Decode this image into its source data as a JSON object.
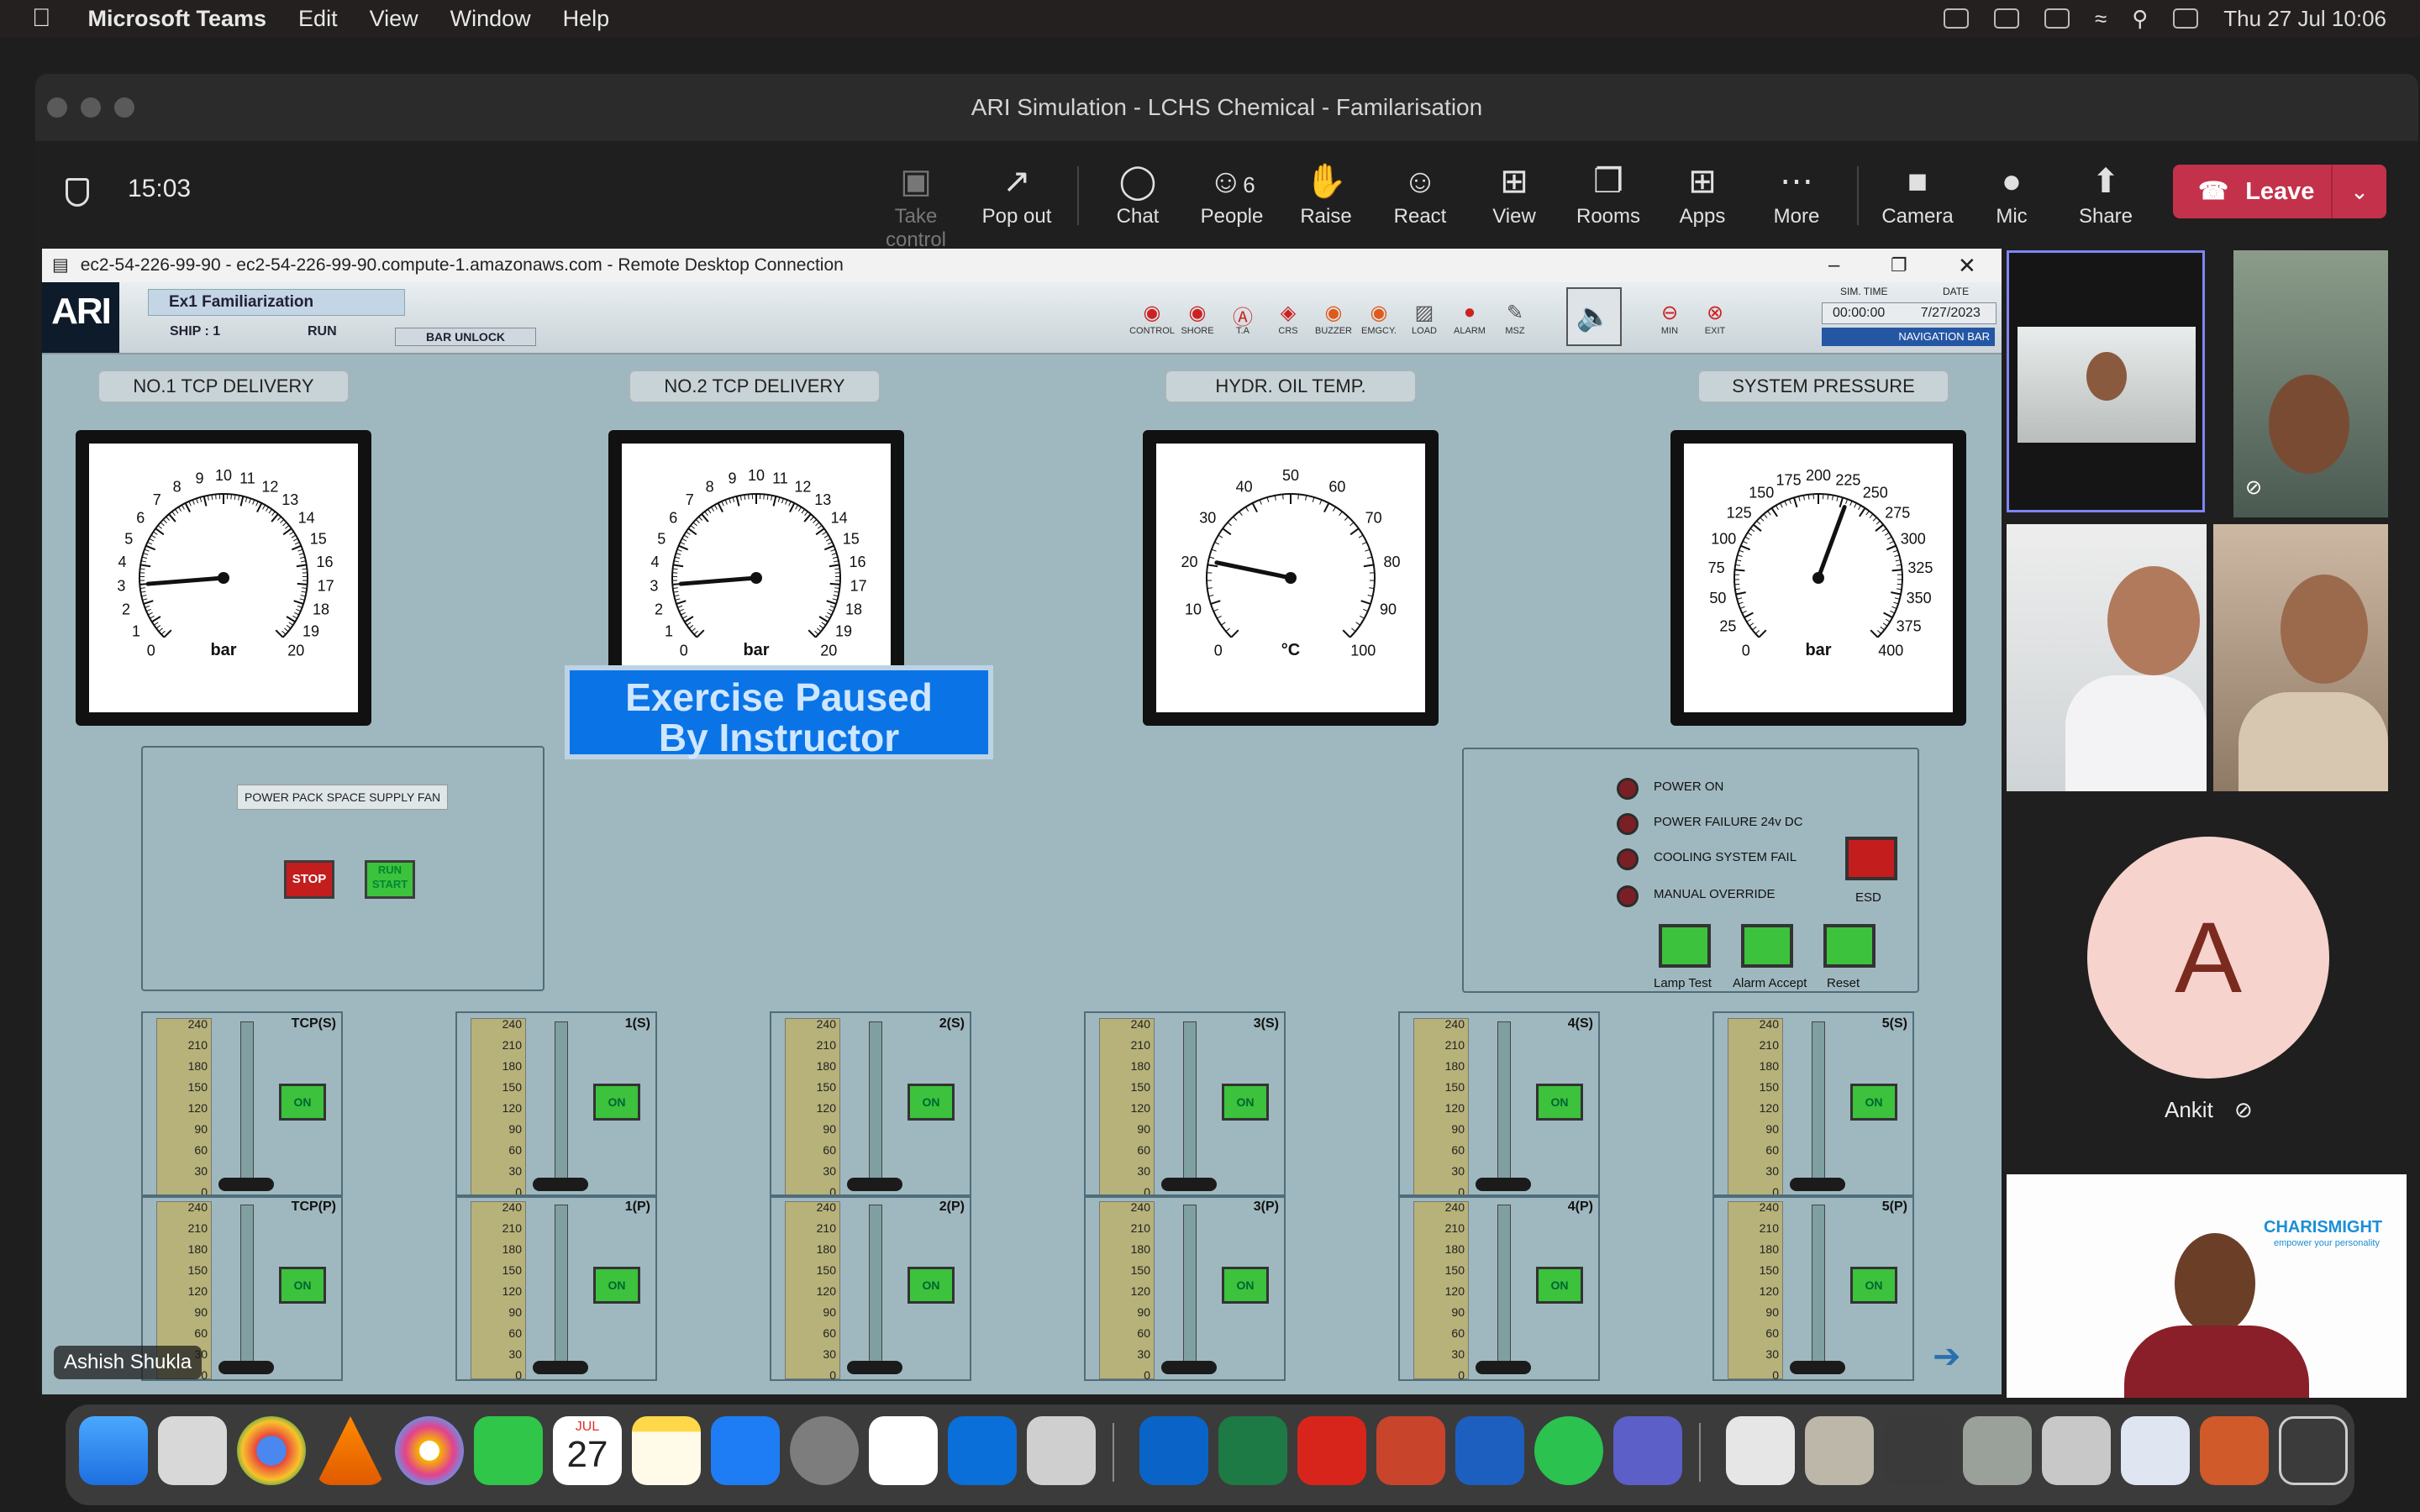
{
  "menubar": {
    "app_name": "Microsoft Teams",
    "items": [
      "Edit",
      "View",
      "Window",
      "Help"
    ],
    "clock": "Thu 27 Jul  10:06"
  },
  "window": {
    "title": "ARI Simulation - LCHS Chemical - Familarisation"
  },
  "meeting": {
    "timer": "15:03",
    "buttons": [
      {
        "label": "Take control",
        "icon": "take-control-icon"
      },
      {
        "label": "Pop out",
        "icon": "pop-out-icon"
      },
      {
        "label": "Chat",
        "icon": "chat-icon"
      },
      {
        "label": "People",
        "icon": "people-icon",
        "count": "6"
      },
      {
        "label": "Raise",
        "icon": "raise-hand-icon"
      },
      {
        "label": "React",
        "icon": "react-icon"
      },
      {
        "label": "View",
        "icon": "view-icon"
      },
      {
        "label": "Rooms",
        "icon": "rooms-icon"
      },
      {
        "label": "Apps",
        "icon": "apps-icon"
      },
      {
        "label": "More",
        "icon": "more-icon"
      },
      {
        "label": "Camera",
        "icon": "camera-icon"
      },
      {
        "label": "Mic",
        "icon": "mic-icon"
      },
      {
        "label": "Share",
        "icon": "share-icon"
      }
    ],
    "leave_label": "Leave",
    "leave_color": "#c4314b"
  },
  "rdp": {
    "title": "ec2-54-226-99-90 - ec2-54-226-99-90.compute-1.amazonaws.com - Remote Desktop Connection",
    "presenter_name": "Ashish Shukla"
  },
  "sim": {
    "logo": "ARI",
    "exercise": "Ex1 Familiarization",
    "ship": "SHIP : 1",
    "run": "RUN",
    "bar_unlock": "BAR UNLOCK",
    "toolbar": [
      "CONTROL",
      "SHORE",
      "T.A",
      "CRS",
      "BUZZER",
      "EMGCY.",
      "LOAD",
      "ALARM",
      "MSZ",
      "MIN",
      "EXIT"
    ],
    "sim_time_label": "SIM. TIME",
    "sim_time": "00:00:00",
    "date_label": "DATE",
    "date": "7/27/2023",
    "nav_bar": "NAVIGATION BAR",
    "paused_line1": "Exercise Paused",
    "paused_line2": "By Instructor",
    "gauges": [
      {
        "title": "NO.1 TCP DELIVERY",
        "unit": "bar",
        "ticks": [
          "0",
          "1",
          "2",
          "3",
          "4",
          "5",
          "6",
          "7",
          "8",
          "9",
          "10",
          "11",
          "12",
          "13",
          "14",
          "15",
          "16",
          "17",
          "18",
          "19",
          "20"
        ],
        "min": 0,
        "max": 20,
        "value": 3
      },
      {
        "title": "NO.2 TCP DELIVERY",
        "unit": "bar",
        "ticks": [
          "0",
          "1",
          "2",
          "3",
          "4",
          "5",
          "6",
          "7",
          "8",
          "9",
          "10",
          "11",
          "12",
          "13",
          "14",
          "15",
          "16",
          "17",
          "18",
          "19",
          "20"
        ],
        "min": 0,
        "max": 20,
        "value": 3
      },
      {
        "title": "HYDR. OIL TEMP.",
        "unit": "°C",
        "ticks": [
          "0",
          "10",
          "20",
          "30",
          "40",
          "50",
          "60",
          "70",
          "80",
          "90",
          "100"
        ],
        "min": 0,
        "max": 100,
        "value": 21
      },
      {
        "title": "SYSTEM PRESSURE",
        "unit": "bar",
        "ticks": [
          "0",
          "25",
          "50",
          "75",
          "100",
          "125",
          "150",
          "175",
          "200",
          "225",
          "250",
          "275",
          "300",
          "325",
          "350",
          "375",
          "400"
        ],
        "min": 0,
        "max": 400,
        "value": 230
      }
    ],
    "fan_panel": {
      "label": "POWER PACK SPACE SUPPLY FAN",
      "stop": "STOP",
      "run_start_1": "RUN",
      "run_start_2": "START"
    },
    "alarm_panel": {
      "lamps": [
        "POWER ON",
        "POWER FAILURE 24v DC",
        "COOLING SYSTEM FAIL",
        "MANUAL OVERRIDE"
      ],
      "esd": "ESD",
      "buttons": [
        "Lamp Test",
        "Alarm Accept",
        "Reset"
      ]
    },
    "scale_ticks": [
      "240",
      "210",
      "180",
      "150",
      "120",
      "90",
      "60",
      "30",
      "0"
    ],
    "pumps": [
      {
        "label": "TCP(S)",
        "on": "ON"
      },
      {
        "label": "1(S)",
        "on": "ON"
      },
      {
        "label": "2(S)",
        "on": "ON"
      },
      {
        "label": "3(S)",
        "on": "ON"
      },
      {
        "label": "4(S)",
        "on": "ON"
      },
      {
        "label": "5(S)",
        "on": "ON"
      },
      {
        "label": "TCP(P)",
        "on": "ON"
      },
      {
        "label": "1(P)",
        "on": "ON"
      },
      {
        "label": "2(P)",
        "on": "ON"
      },
      {
        "label": "3(P)",
        "on": "ON"
      },
      {
        "label": "4(P)",
        "on": "ON"
      },
      {
        "label": "5(P)",
        "on": "ON"
      }
    ]
  },
  "participants": {
    "avatar_initial": "A",
    "avatar_name": "Ankit",
    "brand": "CHARISMIGHT",
    "brand_tag": "empower your personality"
  },
  "dock": {
    "calendar_month": "JUL",
    "calendar_day": "27"
  }
}
